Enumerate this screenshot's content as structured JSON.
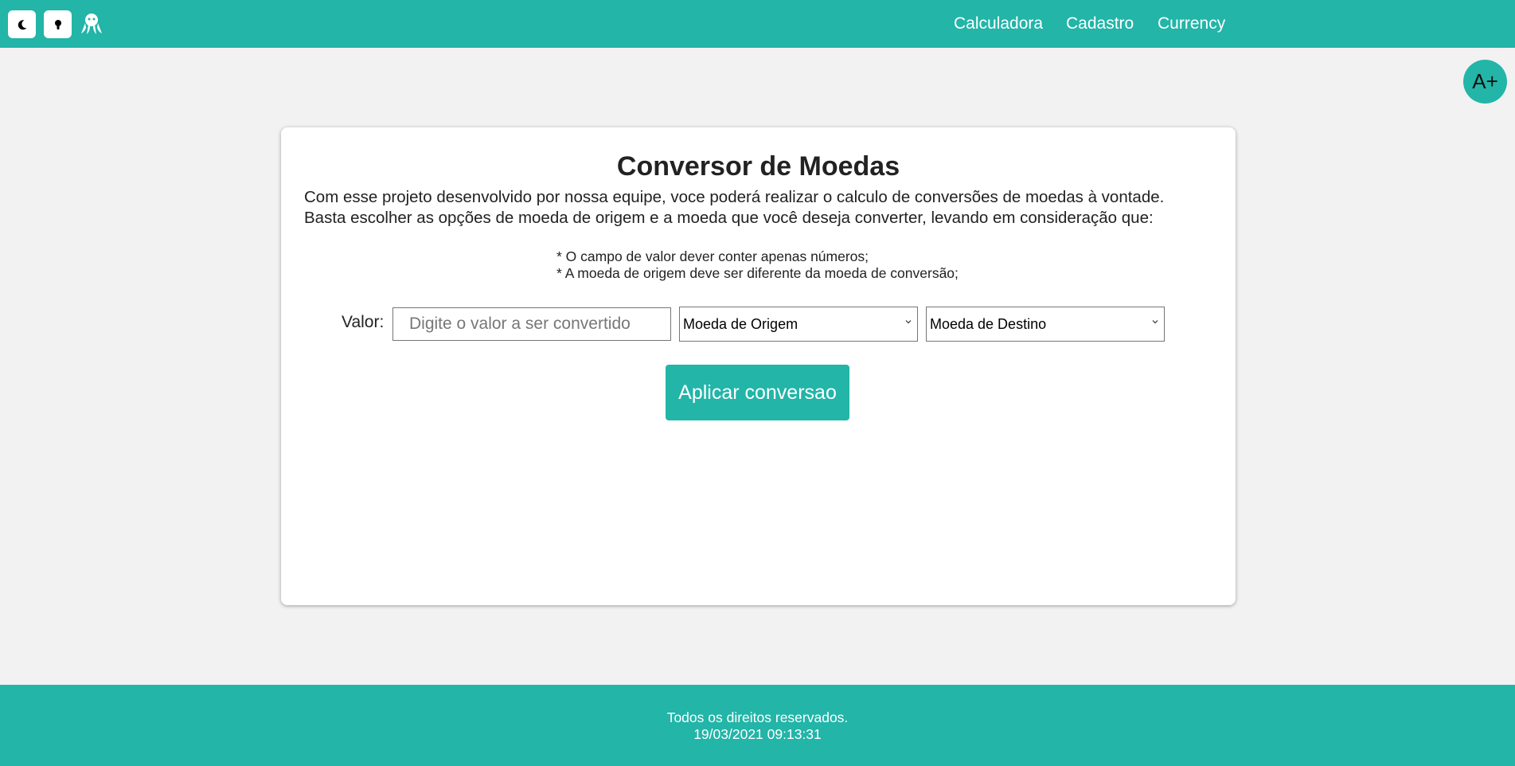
{
  "header": {
    "theme_icon": "moon-icon",
    "contrast_icon": "lightbulb-icon",
    "logo_icon": "octopus-icon",
    "nav": [
      "Calculadora",
      "Cadastro",
      "Currency"
    ],
    "accent_color": "#22b5a8"
  },
  "accessibility": {
    "font_increase_label": "A+"
  },
  "card": {
    "title": "Conversor de Moedas",
    "description_line1": "Com esse projeto desenvolvido por nossa equipe, voce poderá realizar o calculo de conversões de moedas à vontade.",
    "description_line2": "Basta escolher as opções de moeda de origem e a moeda que você deseja converter, levando em consideração que:",
    "note1": "* O campo de valor dever conter apenas números;",
    "note2": "* A moeda de origem deve ser diferente da moeda de conversão;",
    "valor_label": "Valor:",
    "valor_placeholder": "Digite o valor a ser convertido",
    "origin_select": "Moeda de Origem",
    "destination_select": "Moeda de Destino",
    "apply_button": "Aplicar conversao"
  },
  "footer": {
    "rights": "Todos os direitos reservados.",
    "datetime": "19/03/2021 09:13:31"
  }
}
